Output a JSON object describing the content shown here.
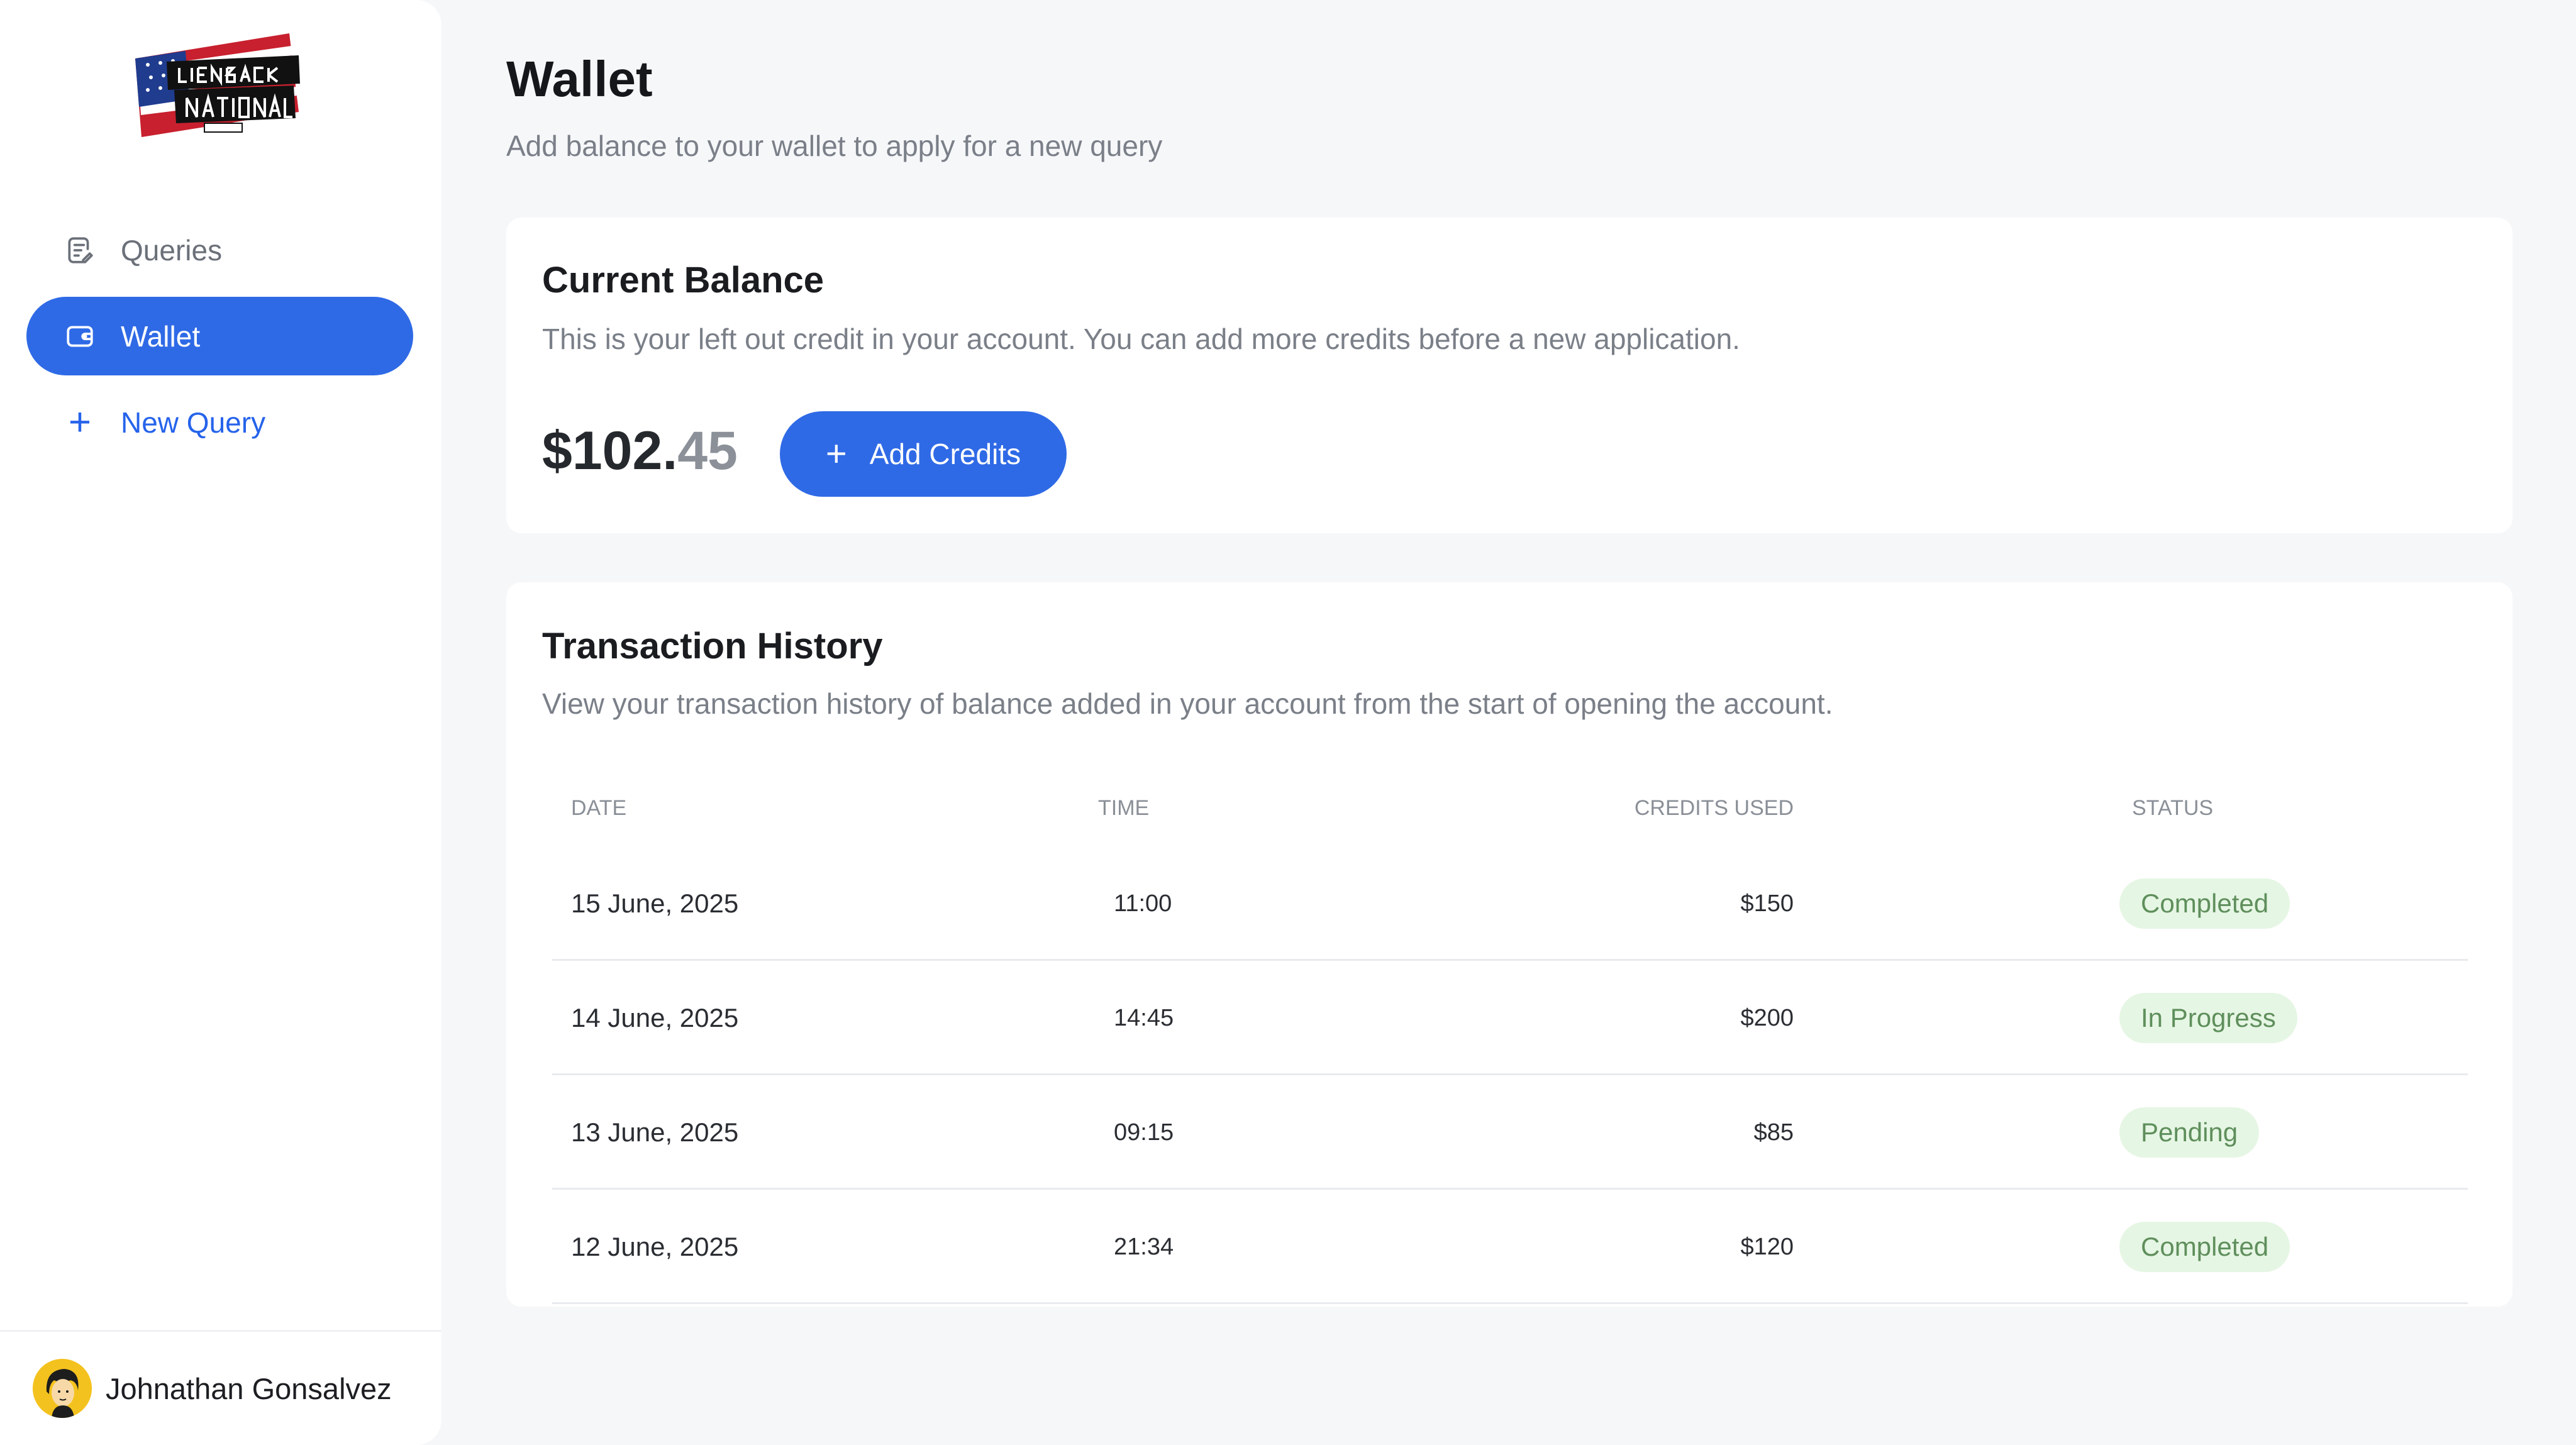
{
  "logo": {
    "alt_text": "Lienback National"
  },
  "sidebar": {
    "items": [
      {
        "label": "Queries",
        "icon": "document-edit-icon",
        "active": false
      },
      {
        "label": "Wallet",
        "icon": "wallet-icon",
        "active": true
      },
      {
        "label": "New Query",
        "icon": "plus-icon",
        "active": false
      }
    ],
    "user": {
      "name": "Johnathan Gonsalvez",
      "avatar": "avatar"
    }
  },
  "page": {
    "title": "Wallet",
    "subtitle": "Add balance to your wallet to apply for a new query"
  },
  "balance": {
    "title": "Current Balance",
    "description": "This is your left out credit in your account. You can add more credits before a new application.",
    "amount_main": "$102.",
    "amount_cents": "45",
    "add_label": "Add Credits"
  },
  "history": {
    "title": "Transaction History",
    "description": "View your transaction history of balance added in your account from the start of opening the account.",
    "columns": [
      "DATE",
      "TIME",
      "CREDITS USED",
      "STATUS"
    ],
    "rows": [
      {
        "date": "15 June, 2025",
        "time": "11:00",
        "credits": "$150",
        "status": "Completed"
      },
      {
        "date": "14 June, 2025",
        "time": "14:45",
        "credits": "$200",
        "status": "In Progress"
      },
      {
        "date": "13 June, 2025",
        "time": "09:15",
        "credits": "$85",
        "status": "Pending"
      },
      {
        "date": "12 June, 2025",
        "time": "21:34",
        "credits": "$120",
        "status": "Completed"
      }
    ]
  },
  "colors": {
    "accent": "#2f6ae6",
    "badge_bg": "#e6f6e4",
    "badge_text": "#5f8f5c"
  }
}
